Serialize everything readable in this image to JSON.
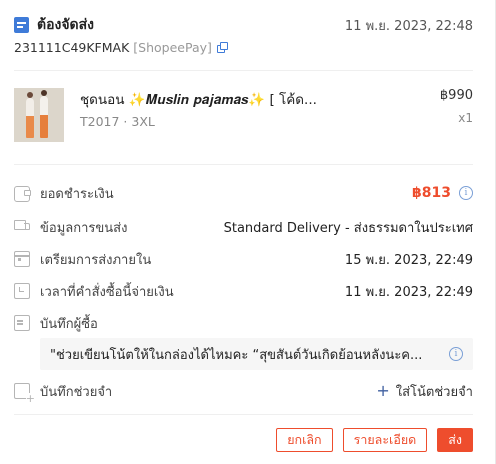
{
  "order": {
    "status": "ต้องจัดส่ง",
    "time": "11 พ.ย. 2023, 22:48",
    "id": "231111C49KFMAK",
    "payment_tag": "[ShopeePay]"
  },
  "product": {
    "name": "ชุดนอน ✨𝑴𝒖𝒔𝒍𝒊𝒏 𝒑𝒂𝒋𝒂𝒎𝒂𝒔✨ [ โค้ด...",
    "variant": "T2017 · 3XL",
    "price": "฿990",
    "qty": "x1"
  },
  "details": {
    "payment_label": "ยอดชำระเงิน",
    "payment_value": "฿813",
    "shipping_label": "ข้อมูลการขนส่ง",
    "shipping_value": "Standard Delivery - ส่งธรรมดาในประเทศ",
    "prepare_label": "เตรียมการส่งภายใน",
    "prepare_value": "15 พ.ย. 2023, 22:49",
    "cancel_by_label": "เวลาที่คำสั่งซื้อนี้จ่ายเงิน",
    "cancel_by_value": "11 พ.ย. 2023, 22:49",
    "buyer_note_label": "บันทึกผู้ซื้อ",
    "buyer_note_text": "\"ช่วยเขียนโน้ตให้ในกล่องได้ไหมคะ “สุขสันต์วันเกิดย้อนหลังนะค...",
    "memo_label": "บันทึกช่วยจำ",
    "memo_add": "ใส่โน้ตช่วยจำ"
  },
  "actions": {
    "cancel": "ยกเลิก",
    "details": "รายละเอียด",
    "ship": "ส่ง"
  },
  "colors": {
    "accent": "#ee4d2d",
    "link": "#3f7bd8"
  },
  "icons": {
    "header": "document-icon",
    "copy": "copy-icon",
    "payment": "wallet-icon",
    "shipping": "truck-icon",
    "prepare": "calendar-icon",
    "paid_time": "clock-calendar-icon",
    "buyer_note": "note-icon",
    "memo": "memo-add-icon",
    "info": "info-icon"
  }
}
